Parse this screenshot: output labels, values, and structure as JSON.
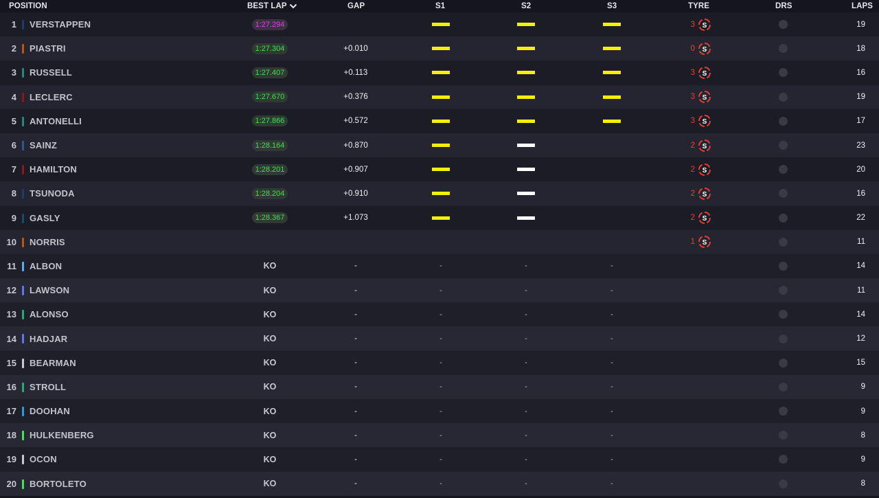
{
  "header": {
    "position": "POSITION",
    "best_lap": "BEST LAP",
    "gap": "GAP",
    "s1": "S1",
    "s2": "S2",
    "s3": "S3",
    "tyre": "TYRE",
    "drs": "DRS",
    "laps": "LAPS"
  },
  "colors": {
    "sector_yellow": "#f5f000",
    "sector_white": "#ffffff",
    "best_lap_green": "#41e04f",
    "best_lap_purple": "#d843e6",
    "tyre_soft_red": "#e8402c"
  },
  "rows": [
    {
      "pos": "1",
      "name": "VERSTAPPEN",
      "team_color": "#1e3a6e",
      "best_lap": "1:27.294",
      "lap_style": "purple",
      "gap": "",
      "s1": "yellow",
      "s2": "yellow",
      "s3": "yellow",
      "tyre_laps": "3",
      "tyre": "S",
      "laps": "19"
    },
    {
      "pos": "2",
      "name": "PIASTRI",
      "team_color": "#b05a1a",
      "best_lap": "1:27.304",
      "lap_style": "green",
      "gap": "+0.010",
      "s1": "yellow",
      "s2": "yellow",
      "s3": "yellow",
      "tyre_laps": "0",
      "tyre": "S",
      "laps": "18"
    },
    {
      "pos": "3",
      "name": "RUSSELL",
      "team_color": "#1f8a78",
      "best_lap": "1:27.407",
      "lap_style": "green",
      "gap": "+0.113",
      "s1": "yellow",
      "s2": "yellow",
      "s3": "yellow",
      "tyre_laps": "3",
      "tyre": "S",
      "laps": "16"
    },
    {
      "pos": "4",
      "name": "LECLERC",
      "team_color": "#8a1a1a",
      "best_lap": "1:27.670",
      "lap_style": "green",
      "gap": "+0.376",
      "s1": "yellow",
      "s2": "yellow",
      "s3": "yellow",
      "tyre_laps": "3",
      "tyre": "S",
      "laps": "19"
    },
    {
      "pos": "5",
      "name": "ANTONELLI",
      "team_color": "#1f8a78",
      "best_lap": "1:27.866",
      "lap_style": "green",
      "gap": "+0.572",
      "s1": "yellow",
      "s2": "yellow",
      "s3": "yellow",
      "tyre_laps": "3",
      "tyre": "S",
      "laps": "17"
    },
    {
      "pos": "6",
      "name": "SAINZ",
      "team_color": "#2a5a8a",
      "best_lap": "1:28.164",
      "lap_style": "green",
      "gap": "+0.870",
      "s1": "yellow",
      "s2": "white",
      "s3": "",
      "tyre_laps": "2",
      "tyre": "S",
      "laps": "23"
    },
    {
      "pos": "7",
      "name": "HAMILTON",
      "team_color": "#8a1a1a",
      "best_lap": "1:28.201",
      "lap_style": "green",
      "gap": "+0.907",
      "s1": "yellow",
      "s2": "white",
      "s3": "",
      "tyre_laps": "2",
      "tyre": "S",
      "laps": "20"
    },
    {
      "pos": "8",
      "name": "TSUNODA",
      "team_color": "#1e3a6e",
      "best_lap": "1:28.204",
      "lap_style": "green",
      "gap": "+0.910",
      "s1": "yellow",
      "s2": "white",
      "s3": "",
      "tyre_laps": "2",
      "tyre": "S",
      "laps": "16"
    },
    {
      "pos": "9",
      "name": "GASLY",
      "team_color": "#1a4a6a",
      "best_lap": "1:28.367",
      "lap_style": "green",
      "gap": "+1.073",
      "s1": "yellow",
      "s2": "white",
      "s3": "",
      "tyre_laps": "2",
      "tyre": "S",
      "laps": "22"
    },
    {
      "pos": "10",
      "name": "NORRIS",
      "team_color": "#b05a1a",
      "best_lap": "",
      "lap_style": "",
      "gap": "",
      "s1": "",
      "s2": "",
      "s3": "",
      "tyre_laps": "1",
      "tyre": "S",
      "laps": "11"
    },
    {
      "pos": "11",
      "name": "ALBON",
      "team_color": "#5aaaf0",
      "best_lap": "KO",
      "lap_style": "ko",
      "gap": "-",
      "s1": "-",
      "s2": "-",
      "s3": "-",
      "tyre_laps": "",
      "tyre": "",
      "laps": "14"
    },
    {
      "pos": "12",
      "name": "LAWSON",
      "team_color": "#5a78e8",
      "best_lap": "KO",
      "lap_style": "ko",
      "gap": "-",
      "s1": "-",
      "s2": "-",
      "s3": "-",
      "tyre_laps": "",
      "tyre": "",
      "laps": "11"
    },
    {
      "pos": "13",
      "name": "ALONSO",
      "team_color": "#2aa878",
      "best_lap": "KO",
      "lap_style": "ko",
      "gap": "-",
      "s1": "-",
      "s2": "-",
      "s3": "-",
      "tyre_laps": "",
      "tyre": "",
      "laps": "14"
    },
    {
      "pos": "14",
      "name": "HADJAR",
      "team_color": "#5a78e8",
      "best_lap": "KO",
      "lap_style": "ko",
      "gap": "-",
      "s1": "-",
      "s2": "-",
      "s3": "-",
      "tyre_laps": "",
      "tyre": "",
      "laps": "12"
    },
    {
      "pos": "15",
      "name": "BEARMAN",
      "team_color": "#c8c8d0",
      "best_lap": "KO",
      "lap_style": "ko",
      "gap": "-",
      "s1": "-",
      "s2": "-",
      "s3": "-",
      "tyre_laps": "",
      "tyre": "",
      "laps": "15"
    },
    {
      "pos": "16",
      "name": "STROLL",
      "team_color": "#2aa878",
      "best_lap": "KO",
      "lap_style": "ko",
      "gap": "-",
      "s1": "-",
      "s2": "-",
      "s3": "-",
      "tyre_laps": "",
      "tyre": "",
      "laps": "9"
    },
    {
      "pos": "17",
      "name": "DOOHAN",
      "team_color": "#2a9ad8",
      "best_lap": "KO",
      "lap_style": "ko",
      "gap": "-",
      "s1": "-",
      "s2": "-",
      "s3": "-",
      "tyre_laps": "",
      "tyre": "",
      "laps": "9"
    },
    {
      "pos": "18",
      "name": "HULKENBERG",
      "team_color": "#4ae05a",
      "best_lap": "KO",
      "lap_style": "ko",
      "gap": "-",
      "s1": "-",
      "s2": "-",
      "s3": "-",
      "tyre_laps": "",
      "tyre": "",
      "laps": "8"
    },
    {
      "pos": "19",
      "name": "OCON",
      "team_color": "#c8c8d0",
      "best_lap": "KO",
      "lap_style": "ko",
      "gap": "-",
      "s1": "-",
      "s2": "-",
      "s3": "-",
      "tyre_laps": "",
      "tyre": "",
      "laps": "9"
    },
    {
      "pos": "20",
      "name": "BORTOLETO",
      "team_color": "#4ae05a",
      "best_lap": "KO",
      "lap_style": "ko",
      "gap": "-",
      "s1": "-",
      "s2": "-",
      "s3": "-",
      "tyre_laps": "",
      "tyre": "",
      "laps": "8"
    }
  ]
}
